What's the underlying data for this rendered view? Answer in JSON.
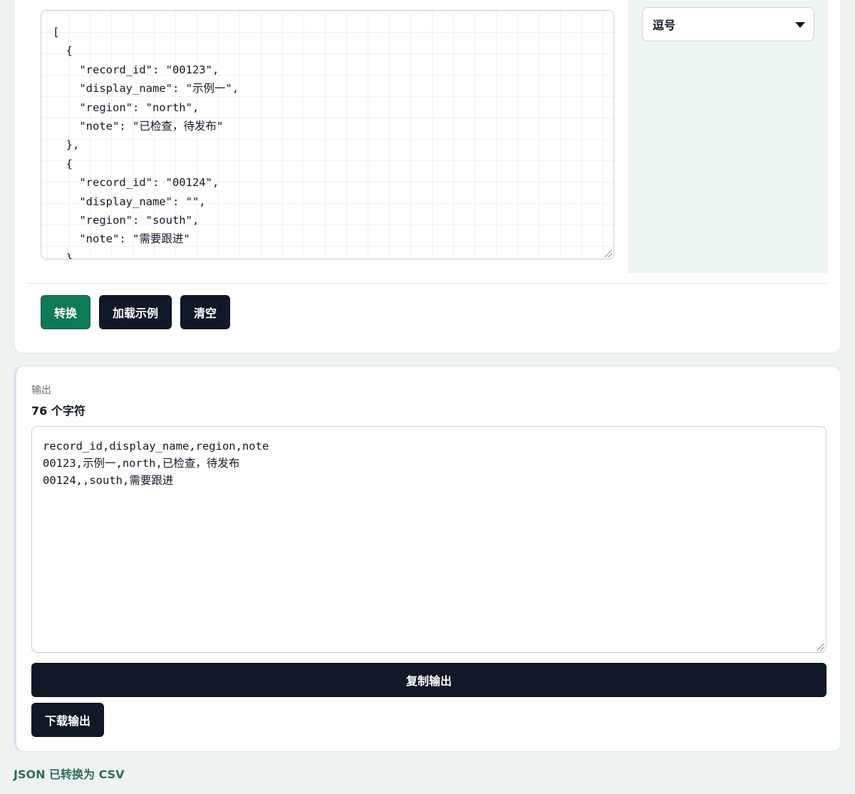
{
  "input": {
    "json_text": "[\n  {\n    \"record_id\": \"00123\",\n    \"display_name\": \"示例一\",\n    \"region\": \"north\",\n    \"note\": \"已检查，待发布\"\n  },\n  {\n    \"record_id\": \"00124\",\n    \"display_name\": \"\",\n    \"region\": \"south\",\n    \"note\": \"需要跟进\"\n  }"
  },
  "options": {
    "delimiter_selected": "逗号",
    "caret_icon": "chevron-down-icon"
  },
  "actions": {
    "convert_label": "转换",
    "load_sample_label": "加载示例",
    "clear_label": "清空"
  },
  "output": {
    "section_label": "输出",
    "char_count": "76 个字符",
    "csv_text": "record_id,display_name,region,note\n00123,示例一,north,已检查，待发布\n00124,,south,需要跟进",
    "copy_label": "复制输出",
    "download_label": "下载输出"
  },
  "status": {
    "message": "JSON 已转换为 CSV"
  },
  "colors": {
    "accent": "#0e7a55",
    "dark_button": "#111827",
    "status_text": "#2e6e58"
  }
}
